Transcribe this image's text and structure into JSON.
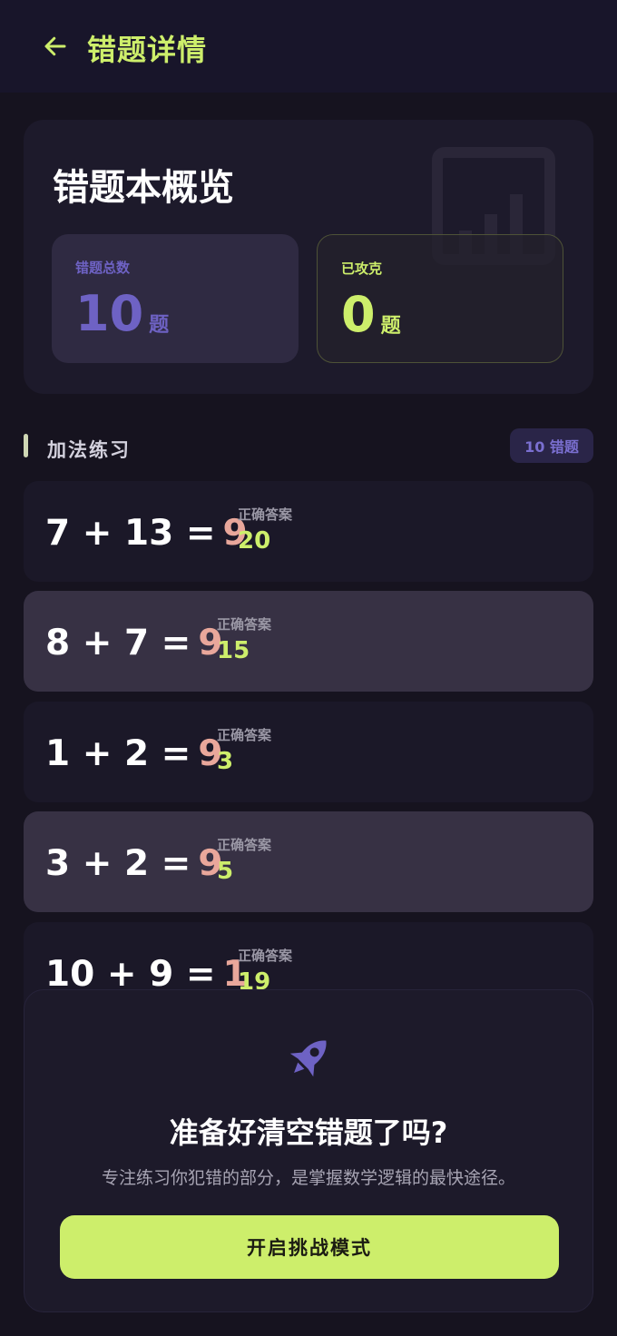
{
  "header": {
    "title": "错题详情",
    "back_icon": "arrow-left-icon"
  },
  "overview": {
    "title": "错题本概览",
    "total": {
      "label": "错题总数",
      "value": "10",
      "unit": "题"
    },
    "conquered": {
      "label": "已攻克",
      "value": "0",
      "unit": "题"
    }
  },
  "section": {
    "title": "加法练习",
    "badge": "10 错题"
  },
  "mistakes": [
    {
      "equation": "7 + 13 =",
      "user_answer": "9",
      "correct_label": "正确答案",
      "correct_value": "20"
    },
    {
      "equation": "8 + 7 =",
      "user_answer": "9",
      "correct_label": "正确答案",
      "correct_value": "15"
    },
    {
      "equation": "1 + 2 =",
      "user_answer": "9",
      "correct_label": "正确答案",
      "correct_value": "3"
    },
    {
      "equation": "3 + 2 =",
      "user_answer": "9",
      "correct_label": "正确答案",
      "correct_value": "5"
    },
    {
      "equation": "10 + 9 =",
      "user_answer": "1",
      "correct_label": "正确答案",
      "correct_value": "19"
    }
  ],
  "cta": {
    "title": "准备好清空错题了吗?",
    "subtitle": "专注练习你犯错的部分，是掌握数学逻辑的最快途径。",
    "button": "开启挑战模式"
  },
  "colors": {
    "accent": "#cdee6b",
    "purple": "#6e62c4",
    "wrong": "#e9a79b"
  }
}
